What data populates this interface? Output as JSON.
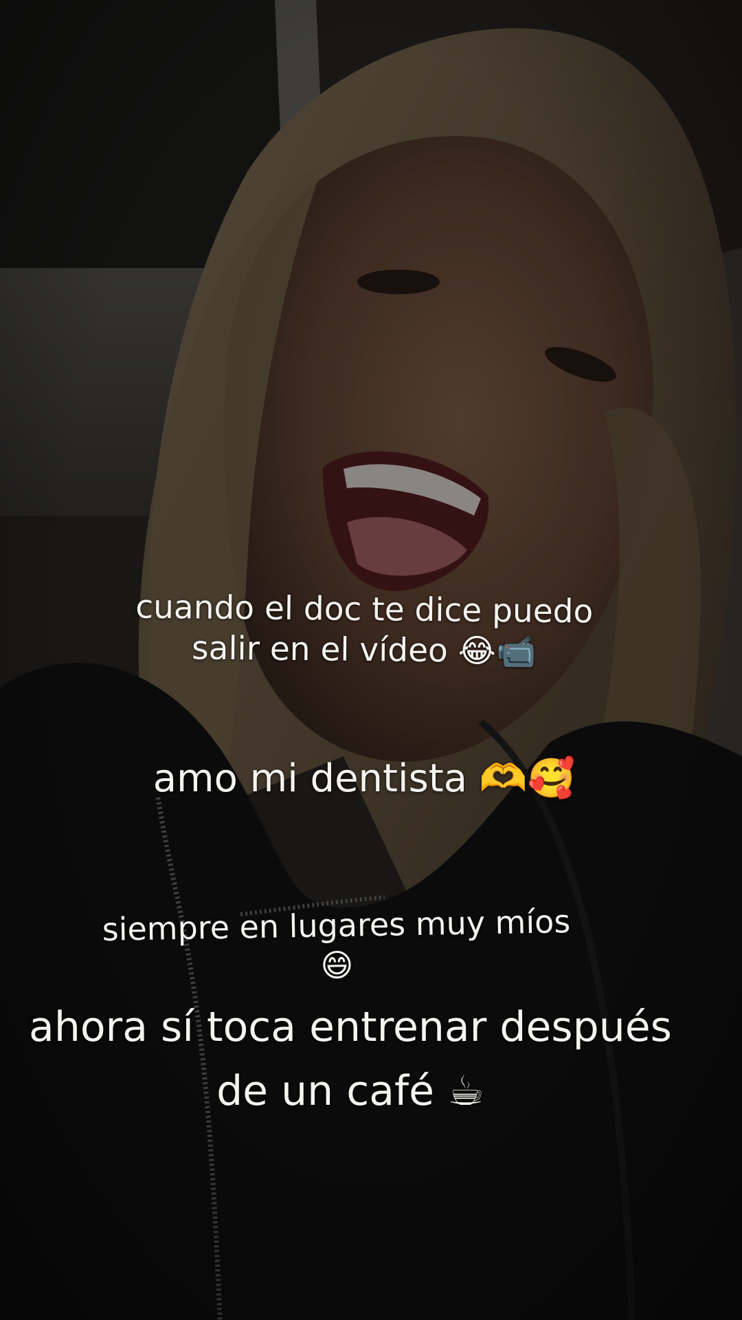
{
  "captions": {
    "line1": "cuando el doc te dice puedo",
    "line2": "salir en el vídeo 😂📹",
    "line3": "amo mi dentista 🫶🥰",
    "line4": "siempre en lugares muy míos",
    "line5": "😄",
    "line6": "ahora sí toca entrenar después",
    "line7": "de un café ☕"
  },
  "colors": {
    "text": "#f6f4f0",
    "background": "#1e1b17",
    "hair": "#7a6a52",
    "skin": "#7a5a45",
    "jacket": "#121212"
  }
}
